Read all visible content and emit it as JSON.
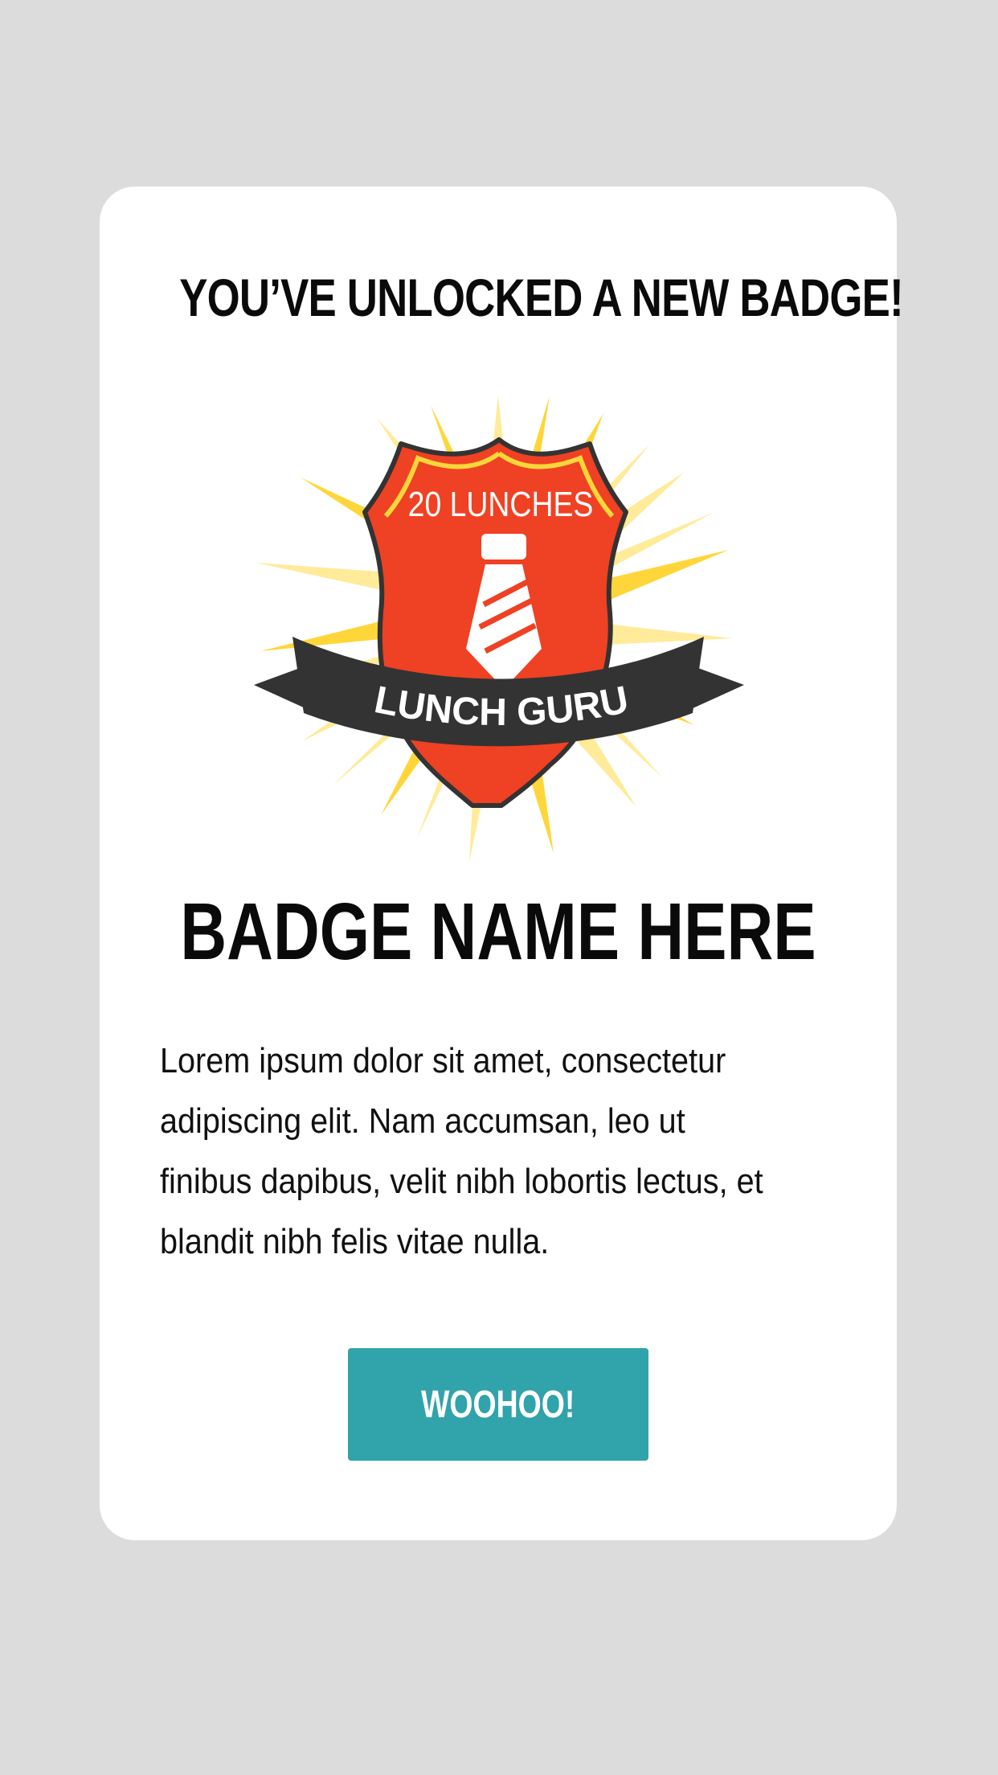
{
  "modal": {
    "headline": "YOU’VE UNLOCKED A NEW BADGE!",
    "badge": {
      "top_text": "20 LUNCHES",
      "ribbon_text": "LUNCH GURU",
      "icon": "necktie-icon"
    },
    "badge_name": "BADGE NAME HERE",
    "description": "Lorem ipsum dolor sit amet, consectetur adipiscing elit. Nam accumsan, leo ut finibus dapibus, velit nibh lobortis lectus, et blandit nibh felis vitae nulla.",
    "button_label": "WOOHOO!"
  },
  "colors": {
    "page_background": "#dcdcdc",
    "card_background": "#ffffff",
    "button": "#31a3aa",
    "shield": "#ef4123",
    "ribbon": "#333333",
    "burst_light": "#ffeb99",
    "burst_dark": "#ffd63a"
  }
}
